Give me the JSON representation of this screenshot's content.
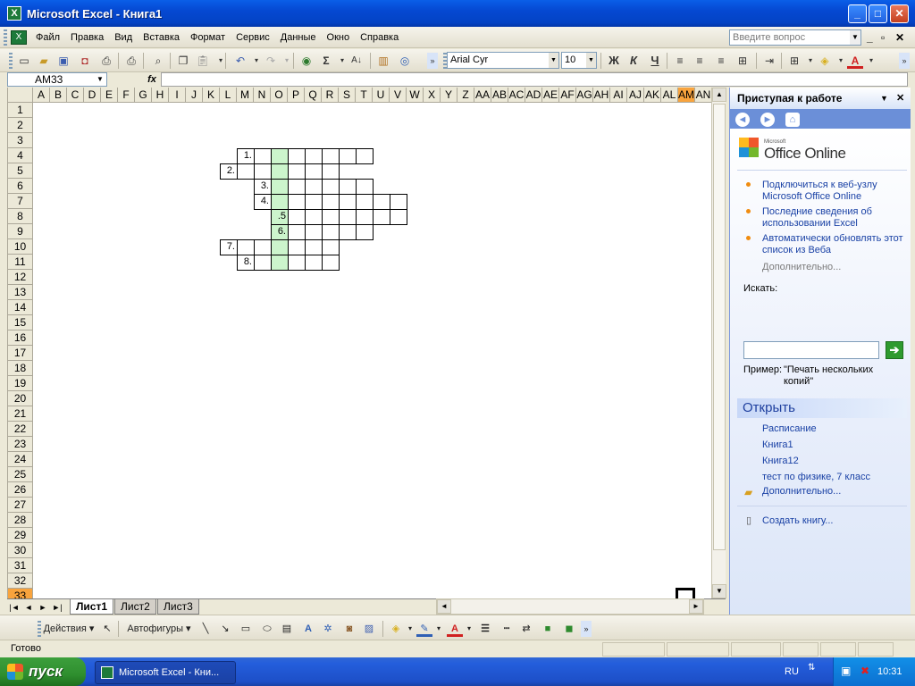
{
  "window": {
    "title": "Microsoft Excel - Книга1",
    "app_icon": "excel-icon"
  },
  "menu": [
    "Файл",
    "Правка",
    "Вид",
    "Вставка",
    "Формат",
    "Сервис",
    "Данные",
    "Окно",
    "Справка"
  ],
  "ask_box": {
    "placeholder": "Введите вопрос"
  },
  "toolbar": {
    "font": "Arial Cyr",
    "size": "10",
    "bold": "Ж",
    "italic": "К",
    "underline": "Ч",
    "sum": "Σ"
  },
  "formula_bar": {
    "name_box": "AM33",
    "fx": "fx",
    "value": ""
  },
  "grid": {
    "columns": [
      "A",
      "B",
      "C",
      "D",
      "E",
      "F",
      "G",
      "H",
      "I",
      "J",
      "K",
      "L",
      "M",
      "N",
      "O",
      "P",
      "Q",
      "R",
      "S",
      "T",
      "U",
      "V",
      "W",
      "X",
      "Y",
      "Z",
      "AA",
      "AB",
      "AC",
      "AD",
      "AE",
      "AF",
      "AG",
      "AH",
      "AI",
      "AJ",
      "AK",
      "AL",
      "AM",
      "AN"
    ],
    "rows": [
      "1",
      "2",
      "3",
      "4",
      "5",
      "6",
      "7",
      "8",
      "9",
      "10",
      "11",
      "12",
      "13",
      "14",
      "15",
      "16",
      "17",
      "18",
      "19",
      "20",
      "21",
      "22",
      "23",
      "24",
      "25",
      "26",
      "27",
      "28",
      "29",
      "30",
      "31",
      "32",
      "33"
    ],
    "selected_column": "AM",
    "selected_row": "33"
  },
  "crossword": {
    "highlight_column": "O",
    "rows": [
      {
        "row": 4,
        "start_col": "M",
        "length": 8,
        "clue": "1."
      },
      {
        "row": 5,
        "start_col": "L",
        "length": 7,
        "clue": "2."
      },
      {
        "row": 6,
        "start_col": "N",
        "length": 7,
        "clue": "3."
      },
      {
        "row": 7,
        "start_col": "N",
        "length": 9,
        "clue": "4."
      },
      {
        "row": 8,
        "start_col": "O",
        "length": 8,
        "clue": ".5"
      },
      {
        "row": 9,
        "start_col": "O",
        "length": 6,
        "clue": "6."
      },
      {
        "row": 10,
        "start_col": "L",
        "length": 7,
        "clue": "7."
      },
      {
        "row": 11,
        "start_col": "M",
        "length": 6,
        "clue": "8."
      }
    ]
  },
  "sheets": [
    "Лист1",
    "Лист2",
    "Лист3"
  ],
  "active_sheet": "Лист1",
  "drawing_toolbar": {
    "actions": "Действия",
    "autoshapes": "Автофигуры"
  },
  "status": "Готово",
  "task_pane": {
    "title": "Приступая к работе",
    "office_online_small": "Microsoft",
    "office_online": "Office Online",
    "links": [
      "Подключиться к веб-узлу Microsoft Office Online",
      "Последние сведения об использовании Excel",
      "Автоматически обновлять этот список из Веба"
    ],
    "more": "Дополнительно...",
    "search_label": "Искать:",
    "example_label": "Пример:",
    "example_text": "\"Печать нескольких копий\"",
    "open_header": "Открыть",
    "recent_files": [
      "Расписание",
      "Книга1",
      "Книга12",
      "тест по физике, 7 класс"
    ],
    "open_more": "Дополнительно...",
    "create": "Создать книгу..."
  },
  "taskbar": {
    "start": "пуск",
    "task": "Microsoft Excel - Кни...",
    "lang": "RU",
    "clock": "10:31"
  }
}
